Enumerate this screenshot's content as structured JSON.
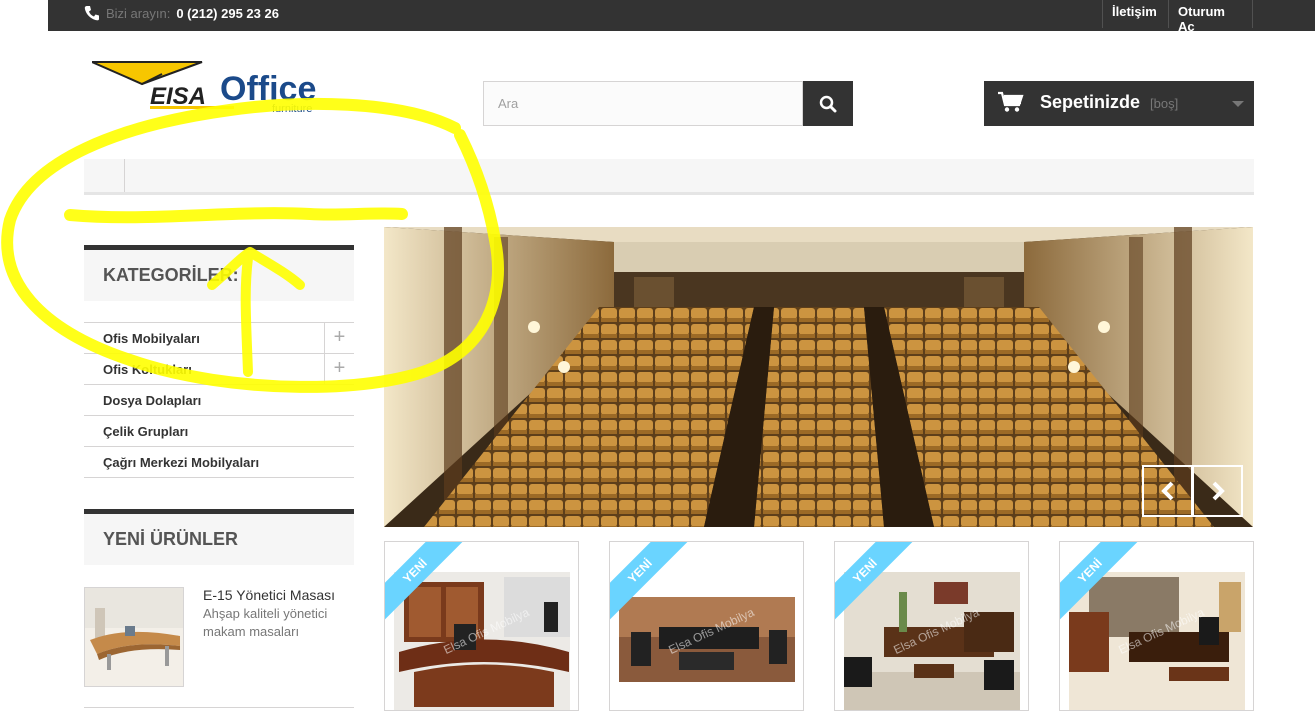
{
  "topbar": {
    "call_label": "Bizi arayın:",
    "phone": "0 (212) 295 23 26",
    "contact_link": "İletişim",
    "login_link": "Oturum Aç"
  },
  "logo": {
    "brand_mark": "EISA",
    "brand_name": "Office",
    "tagline": "furniture"
  },
  "search": {
    "placeholder": "Ara"
  },
  "cart": {
    "label": "Sepetinizde",
    "status": "[boş]"
  },
  "sidebar": {
    "categories_title": "KATEGORİLER:",
    "categories": [
      {
        "label": "Ofis Mobilyaları",
        "expandable": true
      },
      {
        "label": "Ofis Koltukları",
        "expandable": true
      },
      {
        "label": "Dosya Dolapları",
        "expandable": false
      },
      {
        "label": "Çelik Grupları",
        "expandable": false
      },
      {
        "label": "Çağrı Merkezi Mobilyaları",
        "expandable": false
      }
    ],
    "new_products_title": "YENİ ÜRÜNLER",
    "new_product": {
      "name": "E-15 Yönetici Masası",
      "description": "Ahşap kaliteli yönetici makam masaları"
    }
  },
  "products": [
    {
      "badge": "YENİ",
      "watermark": "Elsa Ofis Mobilya"
    },
    {
      "badge": "YENİ",
      "watermark": "Elsa Ofis Mobilya"
    },
    {
      "badge": "YENİ",
      "watermark": "Elsa Ofis Mobilya"
    },
    {
      "badge": "YENİ",
      "watermark": "Elsa Ofis Mobilya"
    }
  ],
  "colors": {
    "dark": "#333333",
    "ribbon": "#6ad4ff",
    "logo_yellow": "#f7c600",
    "logo_blue": "#1b4a8a",
    "annotation": "#ffff00"
  }
}
